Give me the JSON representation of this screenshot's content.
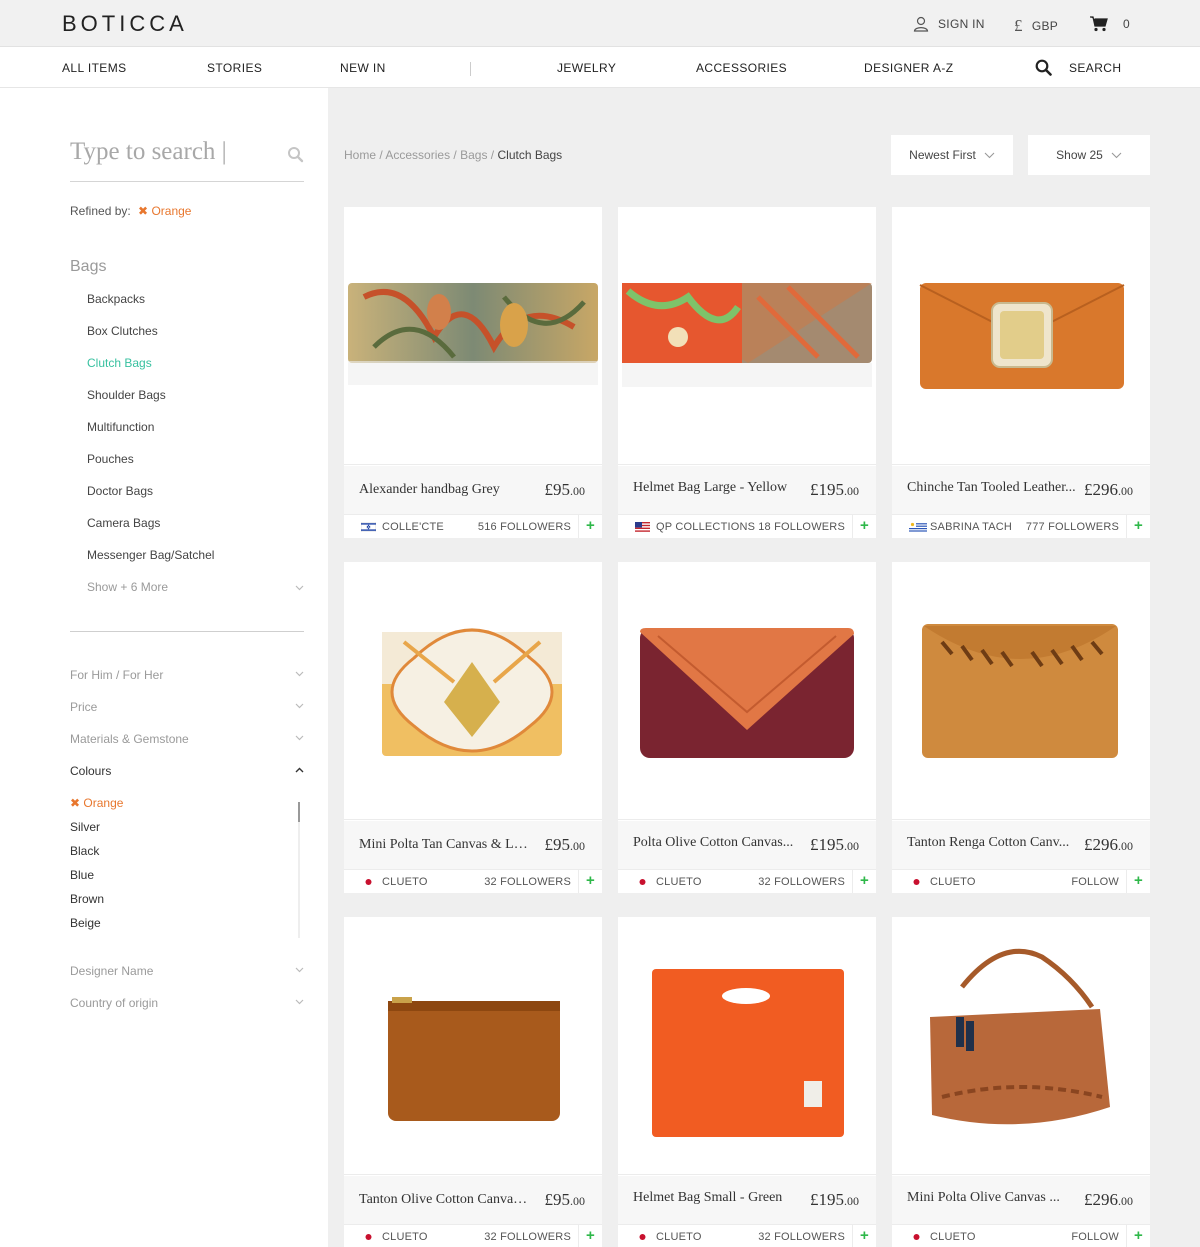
{
  "header": {
    "logo": "BOTICCA",
    "sign_in": "SIGN IN",
    "currency_symbol": "£",
    "currency": "GBP",
    "cart_count": "0"
  },
  "nav": {
    "items": [
      "ALL ITEMS",
      "STORIES",
      "NEW IN",
      "JEWELRY",
      "ACCESSORIES",
      "DESIGNER A-Z"
    ],
    "search": "SEARCH"
  },
  "sidebar": {
    "search_placeholder": "Type to search |",
    "refined_label": "Refined by:",
    "refined_tag": "Orange",
    "category_title": "Bags",
    "categories": [
      "Backpacks",
      "Box Clutches",
      "Clutch Bags",
      "Shoulder Bags",
      "Multifunction",
      "Pouches",
      "Doctor Bags",
      "Camera Bags",
      "Messenger Bag/Satchel"
    ],
    "active_category": "Clutch Bags",
    "show_more": "Show + 6 More",
    "facets": [
      "For Him / For Her",
      "Price",
      "Materials & Gemstone",
      "Colours"
    ],
    "colours": [
      "Orange",
      "Silver",
      "Black",
      "Blue",
      "Brown",
      "Beige"
    ],
    "facets_after": [
      "Designer Name",
      "Country of origin"
    ]
  },
  "main": {
    "breadcrumb": {
      "home": "Home",
      "l1": "Accessories",
      "l2": "Bags",
      "current": "Clutch Bags",
      "sep": "/"
    },
    "sort_label": "Newest First",
    "show_label": "Show 25",
    "products": [
      {
        "name": "Alexander handbag Grey",
        "price_main": "£95",
        "price_dec": ".00",
        "designer": "COLLE'CTE",
        "followers": "516 FOLLOWERS",
        "flag": "israel"
      },
      {
        "name": "Helmet Bag Large - Yellow",
        "price_main": "£195",
        "price_dec": ".00",
        "designer": "QP COLLECTIONS",
        "followers": "18 FOLLOWERS",
        "flag": "usa"
      },
      {
        "name": "Chinche Tan Tooled Leather...",
        "price_main": "£296",
        "price_dec": ".00",
        "designer": "SABRINA TACH",
        "followers": "777 FOLLOWERS",
        "flag": "uruguay"
      },
      {
        "name": "Mini Polta Tan Canvas & Le...",
        "price_main": "£95",
        "price_dec": ".00",
        "designer": "CLUETO",
        "followers": "32 FOLLOWERS",
        "flag": "japan"
      },
      {
        "name": "Polta Olive Cotton Canvas...",
        "price_main": "£195",
        "price_dec": ".00",
        "designer": "CLUETO",
        "followers": "32 FOLLOWERS",
        "flag": "japan"
      },
      {
        "name": "Tanton Renga Cotton Canv...",
        "price_main": "£296",
        "price_dec": ".00",
        "designer": "CLUETO",
        "followers": "FOLLOW",
        "flag": "japan"
      },
      {
        "name": "Tanton Olive Cotton Canvas...",
        "price_main": "£95",
        "price_dec": ".00",
        "designer": "CLUETO",
        "followers": "32 FOLLOWERS",
        "flag": "japan"
      },
      {
        "name": "Helmet Bag Small - Green",
        "price_main": "£195",
        "price_dec": ".00",
        "designer": "CLUETO",
        "followers": "32 FOLLOWERS",
        "flag": "japan"
      },
      {
        "name": "Mini Polta Olive Canvas ...",
        "price_main": "£296",
        "price_dec": ".00",
        "designer": "CLUETO",
        "followers": "FOLLOW",
        "flag": "japan"
      }
    ],
    "follow_plus": "+"
  },
  "colors": {
    "accent_orange": "#e8772e",
    "active_green": "#38c1a0",
    "plus_green": "#2fb84a"
  }
}
